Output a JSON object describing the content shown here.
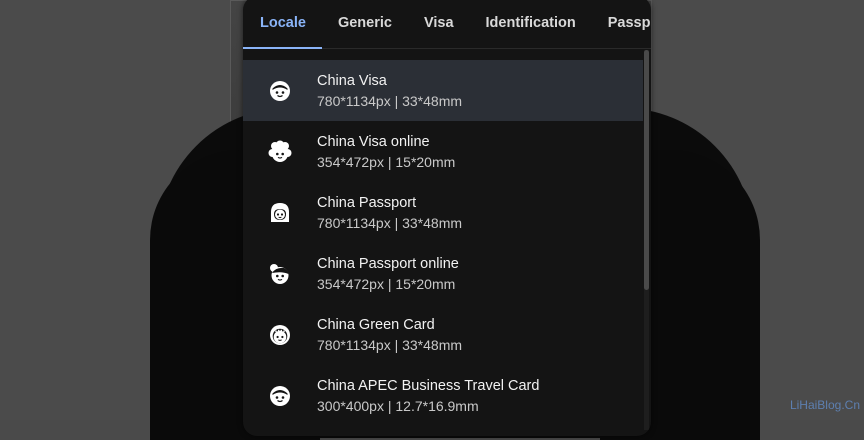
{
  "tabs": [
    {
      "label": "Locale",
      "active": true
    },
    {
      "label": "Generic",
      "active": false
    },
    {
      "label": "Visa",
      "active": false
    },
    {
      "label": "Identification",
      "active": false
    },
    {
      "label": "Passport",
      "active": false
    }
  ],
  "items": [
    {
      "title": "China Visa",
      "subtitle": "780*1134px | 33*48mm",
      "icon": "face-smile-icon",
      "selected": true
    },
    {
      "title": "China Visa online",
      "subtitle": "354*472px | 15*20mm",
      "icon": "face-curly-hair-icon",
      "selected": false
    },
    {
      "title": "China Passport",
      "subtitle": "780*1134px | 33*48mm",
      "icon": "face-long-hair-icon",
      "selected": false
    },
    {
      "title": "China Passport online",
      "subtitle": "354*472px | 15*20mm",
      "icon": "face-bun-hair-icon",
      "selected": false
    },
    {
      "title": "China Green Card",
      "subtitle": "780*1134px | 33*48mm",
      "icon": "face-dotted-hair-icon",
      "selected": false
    },
    {
      "title": "China APEC Business Travel Card",
      "subtitle": "300*400px | 12.7*16.9mm",
      "icon": "face-smile-icon",
      "selected": false
    }
  ],
  "watermark": "LiHaiBlog.Cn",
  "colors": {
    "accent": "#8ab4f8",
    "panel": "#141414",
    "selected_row": "#2b2f36"
  }
}
